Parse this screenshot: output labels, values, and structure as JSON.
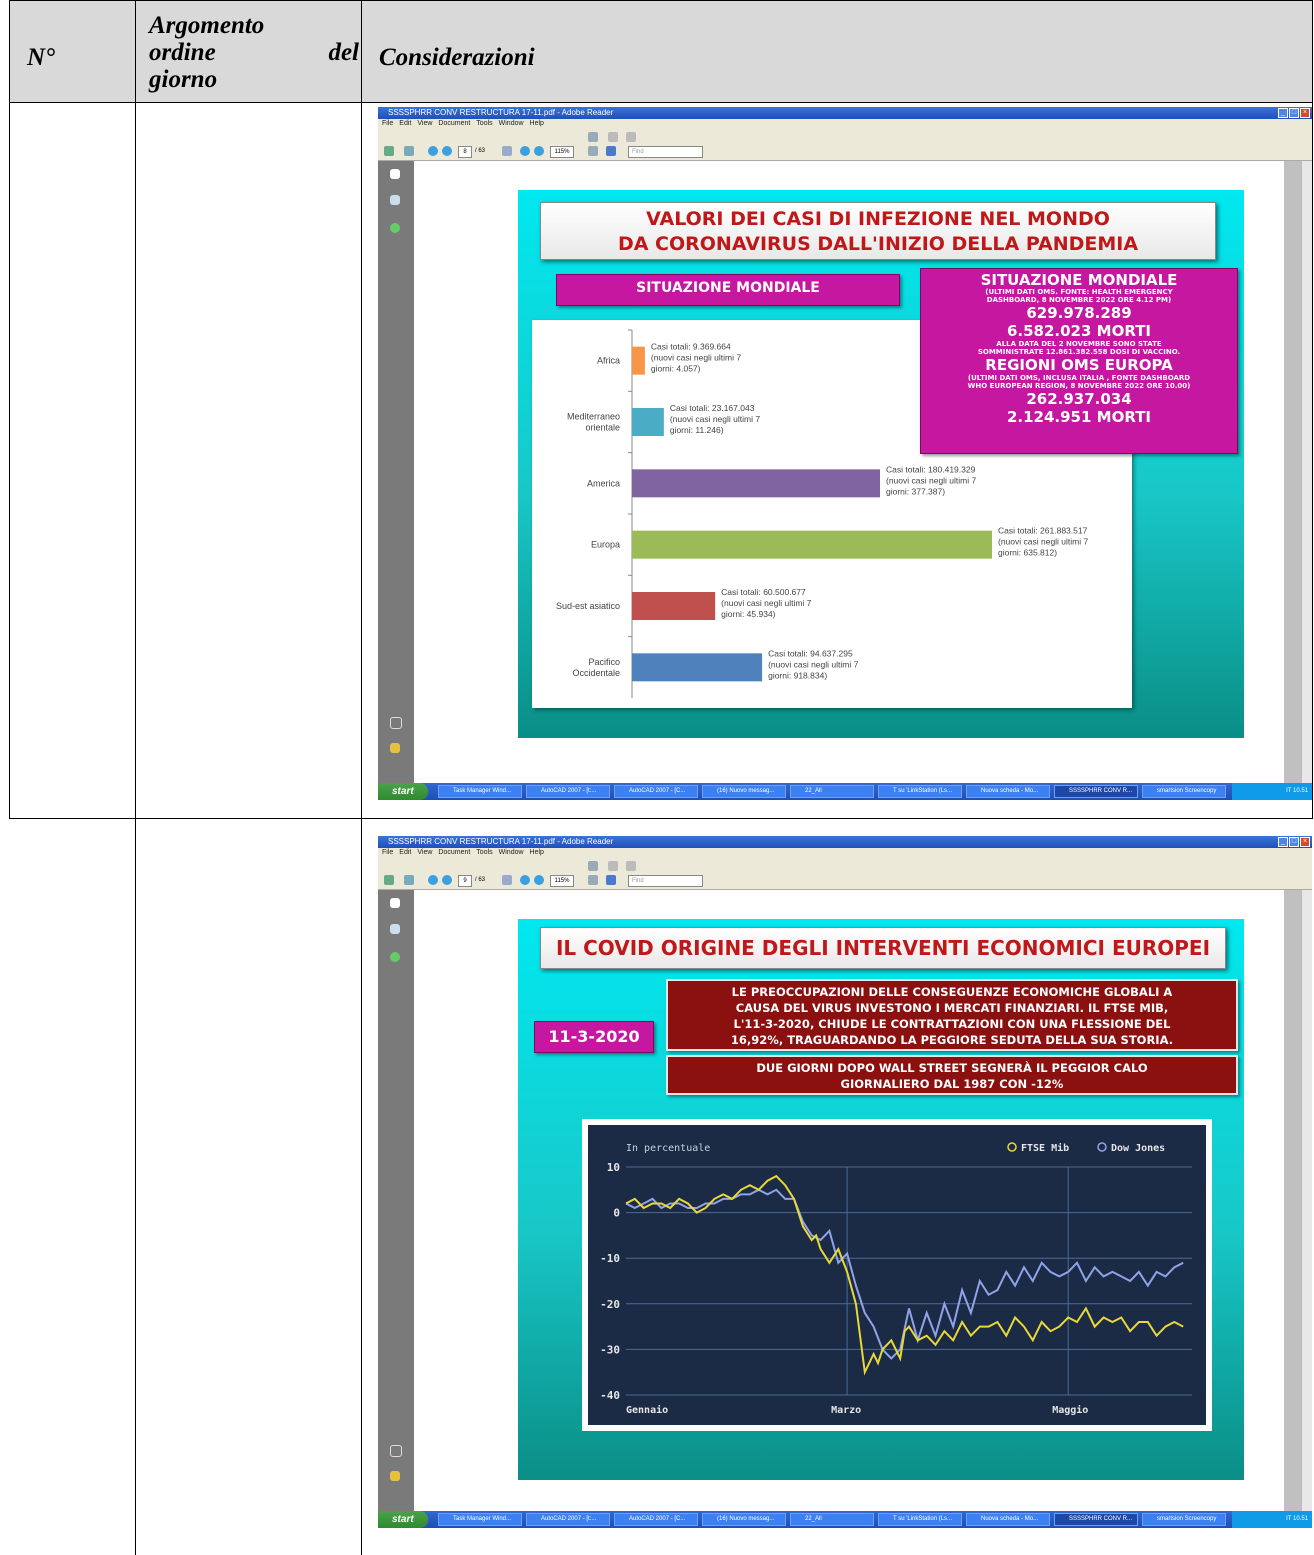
{
  "table": {
    "headers": {
      "col1": "N°",
      "col2_line1": "Argomento",
      "col2_line2": "ordine",
      "col2_line2b": "del",
      "col2_line3": "giorno",
      "col3": "Considerazioni"
    }
  },
  "screens": [
    {
      "window_title": "SSSSPHRR CONV RESTRUCTURA  17-11.pdf - Adobe Reader",
      "menu": [
        "File",
        "Edit",
        "View",
        "Document",
        "Tools",
        "Window",
        "Help"
      ],
      "page_num": "8",
      "page_total": "/ 63",
      "zoom": "115%",
      "find_placeholder": "Find",
      "taskbar": {
        "start": "start",
        "tasks": [
          "Task Manager Wind...",
          "AutoCAD 2007 - [t:...",
          "AutoCAD 2007 - [C...",
          "(16) Nuovo messag...",
          "22_All",
          "T su 'LinkStation (Ls...",
          "Nuova scheda - Mo...",
          "SSSSPHRR CONV R...",
          "smartsion Screencopy"
        ],
        "tray_lang": "IT",
        "clock": "10.51"
      }
    },
    {
      "window_title": "SSSSPHRR CONV RESTRUCTURA  17-11.pdf - Adobe Reader",
      "menu": [
        "File",
        "Edit",
        "View",
        "Document",
        "Tools",
        "Window",
        "Help"
      ],
      "page_num": "9",
      "page_total": "/ 63",
      "zoom": "115%",
      "find_placeholder": "Find",
      "taskbar": {
        "start": "start",
        "tasks": [
          "Task Manager Wind...",
          "AutoCAD 2007 - [t:...",
          "AutoCAD 2007 - [C...",
          "(16) Nuovo messag...",
          "22_All",
          "T su 'LinkStation (Ls...",
          "Nuova scheda - Mo...",
          "SSSSPHRR CONV R...",
          "smartsion Screencopy"
        ],
        "tray_lang": "IT",
        "clock": "10.51"
      }
    }
  ],
  "slide1": {
    "title_line1": "VALORI   DEI CASI DI INFEZIONE NEL MONDO",
    "title_line2": "DA  CORONAVIRUS DALL'INIZIO DELLA PANDEMIA",
    "left_label": "SITUAZIONE MONDIALE",
    "box": {
      "h1": "SITUAZIONE MONDIALE",
      "s1": "(ULTIMI DATI OMS. FONTE: HEALTH EMERGENCY",
      "s2": "DASHBOARD, 8 NOVEMBRE 2022 ORE 4.12 PM)",
      "n1": "629.978.289",
      "n2": "6.582.023 MORTI",
      "s3": "ALLA DATA DEL 2 NOVEMBRE SONO STATE",
      "s4": "SOMMINISTRATE 12.861.382.558 DOSI DI VACCINO.",
      "h2": "REGIONI OMS EUROPA",
      "s5": "(ULTIMI DATI OMS, INCLUSA ITALIA , FONTE DASHBOARD",
      "s6": "WHO EUROPEAN REGION, 8 NOVEMBRE 2022 ORE 10.00)",
      "n3": "262.937.034",
      "n4": "2.124.951 MORTI"
    }
  },
  "slide2": {
    "title": "IL COVID ORIGINE DEGLI INTERVENTI ECONOMICI EUROPEI",
    "date_label": "11-3-2020",
    "box1_l1": "LE PREOCCUPAZIONI DELLE CONSEGUENZE ECONOMICHE GLOBALI A",
    "box1_l2": "CAUSA DEL VIRUS INVESTONO I MERCATI FINANZIARI. IL FTSE MIB,",
    "box1_l3": "L'11-3-2020, CHIUDE LE CONTRATTAZIONI CON UNA FLESSIONE DEL",
    "box1_l4": "16,92%, TRAGUARDANDO LA PEGGIORE SEDUTA DELLA SUA STORIA.",
    "box2_l1": "DUE GIORNI DOPO WALL STREET SEGNERÀ IL PEGGIOR CALO",
    "box2_l2": "GIORNALIERO DAL 1987 CON -12%"
  },
  "chart_data": [
    {
      "type": "bar",
      "orientation": "horizontal",
      "categories": [
        "Africa",
        "Mediterraneo orientale",
        "America",
        "Europa",
        "Sud-est asiatico",
        "Pacifico Occidentale"
      ],
      "category_lines": [
        [
          "Africa"
        ],
        [
          "Mediterraneo",
          "orientale"
        ],
        [
          "America"
        ],
        [
          "Europa"
        ],
        [
          "Sud-est asiatico"
        ],
        [
          "Pacifico",
          "Occidentale"
        ]
      ],
      "values": [
        9369664,
        23167043,
        180419329,
        261883517,
        60500677,
        94637295
      ],
      "colors": [
        "#f79646",
        "#4bacc6",
        "#8064a2",
        "#9bbb59",
        "#c0504d",
        "#4f81bd"
      ],
      "data_labels": [
        [
          "Casi totali: 9.369.664",
          "(nuovi casi negli ultimi 7",
          "giorni: 4.057)"
        ],
        [
          "Casi totali: 23.167.043",
          "(nuovi casi negli ultimi 7",
          "giorni: 11.246)"
        ],
        [
          "Casi totali: 180.419.329",
          "(nuovi casi negli ultimi 7",
          "giorni: 377.387)"
        ],
        [
          "Casi totali: 261.883.517",
          "(nuovi casi negli ultimi 7",
          "giorni: 635.812)"
        ],
        [
          "Casi totali: 60.500.677",
          "(nuovi casi negli ultimi 7",
          "giorni: 45.934)"
        ],
        [
          "Casi totali: 94.637.295",
          "(nuovi casi negli ultimi 7",
          "giorni: 918.834)"
        ]
      ],
      "xlim": [
        0,
        261883517
      ],
      "grid": false,
      "legend": "none"
    },
    {
      "type": "line",
      "ylabel": "In percentuale",
      "ylim": [
        -40,
        10
      ],
      "yticks": [
        10,
        0,
        -10,
        -20,
        -30,
        -40
      ],
      "x_tick_labels": [
        "Gennaio",
        "Marzo",
        "Maggio"
      ],
      "x_tick_positions": [
        0,
        50,
        100
      ],
      "xlim": [
        0,
        128
      ],
      "legend": "top-right",
      "grid": true,
      "background": "#1b2a45",
      "series": [
        {
          "name": "FTSE Mib",
          "color": "#e8d838",
          "x": [
            0,
            2,
            4,
            6,
            8,
            10,
            12,
            14,
            16,
            18,
            20,
            22,
            24,
            26,
            28,
            30,
            32,
            34,
            36,
            38,
            40,
            42,
            43,
            44,
            46,
            48,
            50,
            52,
            54,
            56,
            57,
            58,
            60,
            62,
            63,
            64,
            66,
            68,
            70,
            72,
            74,
            76,
            78,
            80,
            82,
            84,
            86,
            88,
            90,
            92,
            94,
            96,
            98,
            100,
            102,
            104,
            106,
            108,
            110,
            112,
            114,
            116,
            118,
            120,
            122,
            124,
            126
          ],
          "y": [
            2,
            3,
            1,
            2,
            2,
            1,
            3,
            2,
            0,
            1,
            3,
            4,
            3,
            5,
            6,
            5,
            7,
            8,
            6,
            3,
            -3,
            -6,
            -5,
            -8,
            -11,
            -8,
            -13,
            -20,
            -35,
            -31,
            -33,
            -30,
            -28,
            -32,
            -26,
            -25,
            -28,
            -27,
            -29,
            -26,
            -28,
            -24,
            -27,
            -25,
            -25,
            -24,
            -27,
            -23,
            -25,
            -28,
            -24,
            -26,
            -25,
            -23,
            -24,
            -21,
            -25,
            -23,
            -24,
            -23,
            -26,
            -24,
            -24,
            -27,
            -25,
            -24,
            -25
          ]
        },
        {
          "name": "Dow Jones",
          "color": "#8fa3e8",
          "x": [
            0,
            2,
            4,
            6,
            8,
            10,
            12,
            14,
            16,
            18,
            20,
            22,
            24,
            26,
            28,
            30,
            32,
            34,
            36,
            38,
            40,
            42,
            44,
            46,
            48,
            50,
            52,
            54,
            56,
            58,
            60,
            62,
            64,
            66,
            68,
            70,
            72,
            74,
            76,
            78,
            80,
            82,
            84,
            86,
            88,
            90,
            92,
            94,
            96,
            98,
            100,
            102,
            104,
            106,
            108,
            110,
            112,
            114,
            116,
            118,
            120,
            122,
            124,
            126
          ],
          "y": [
            2,
            1,
            2,
            3,
            1,
            2,
            2,
            1,
            1,
            2,
            2,
            3,
            3,
            4,
            4,
            5,
            4,
            5,
            3,
            3,
            -2,
            -5,
            -6,
            -4,
            -11,
            -9,
            -16,
            -22,
            -25,
            -30,
            -32,
            -30,
            -21,
            -28,
            -22,
            -27,
            -20,
            -25,
            -17,
            -22,
            -15,
            -18,
            -17,
            -13,
            -16,
            -12,
            -15,
            -11,
            -13,
            -14,
            -13,
            -11,
            -15,
            -12,
            -14,
            -13,
            -14,
            -15,
            -13,
            -16,
            -13,
            -14,
            -12,
            -11
          ]
        }
      ]
    }
  ]
}
